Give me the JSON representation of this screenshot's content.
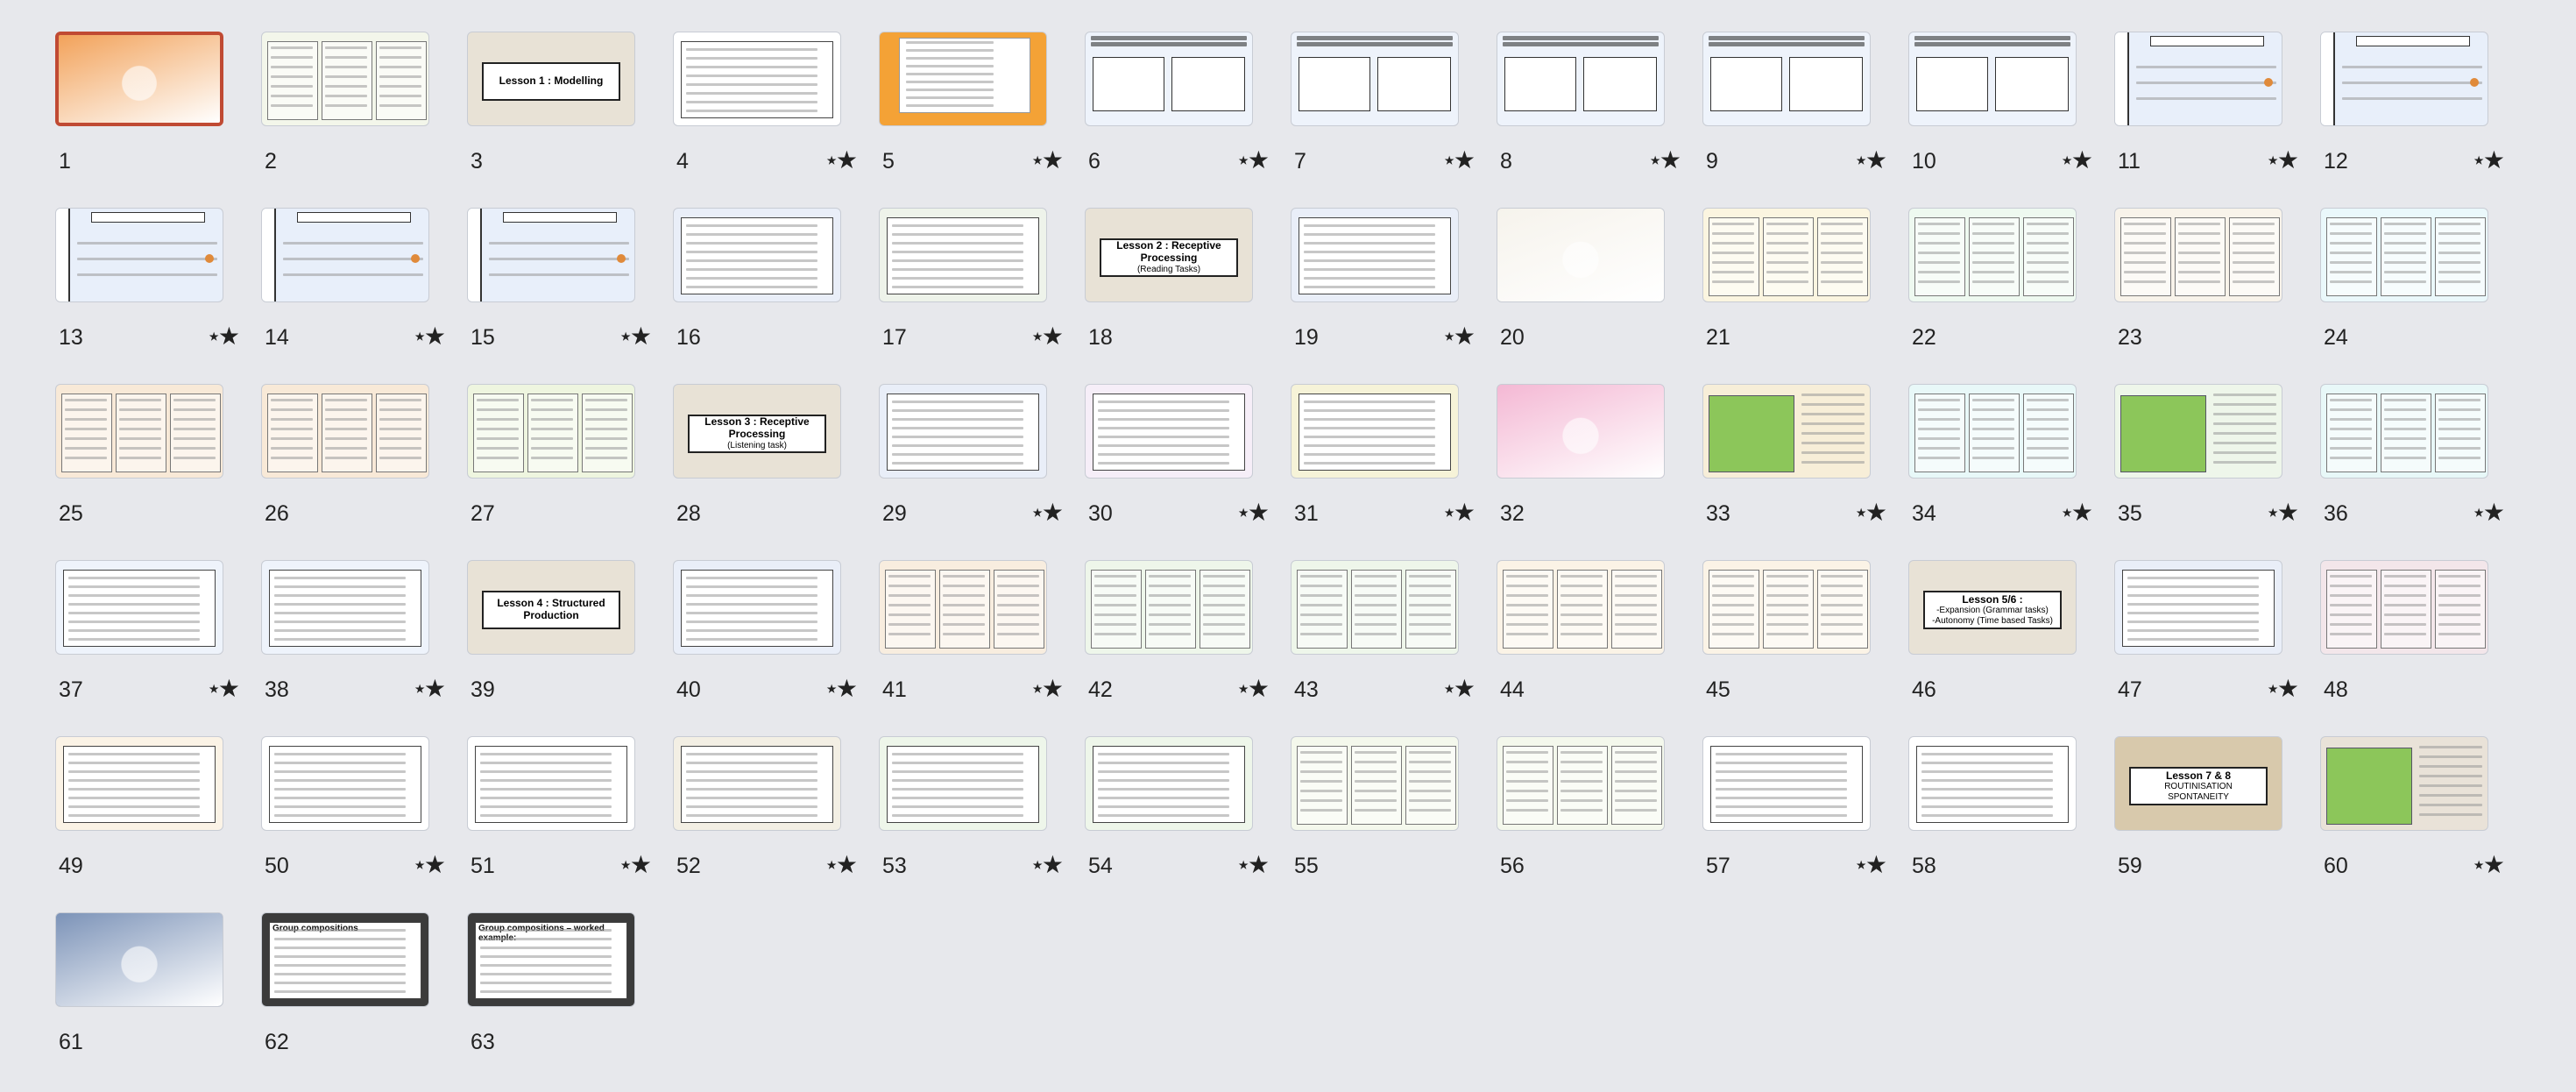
{
  "slides": [
    {
      "n": "1",
      "kind": "image",
      "bg": "#f2a25a",
      "selected": true,
      "text": "",
      "star": false
    },
    {
      "n": "2",
      "kind": "table",
      "bg": "#f3f6ea",
      "text": "",
      "star": false
    },
    {
      "n": "3",
      "kind": "title",
      "bg": "#e8e2d6",
      "text": "Lesson 1 : Modelling",
      "star": false
    },
    {
      "n": "4",
      "kind": "lines",
      "bg": "#ffffff",
      "text": "",
      "star": true
    },
    {
      "n": "5",
      "kind": "orange",
      "bg": "#f4a236",
      "text": "",
      "star": true
    },
    {
      "n": "6",
      "kind": "two",
      "bg": "#eef3fb",
      "text": "",
      "star": true
    },
    {
      "n": "7",
      "kind": "two",
      "bg": "#eef3fb",
      "text": "",
      "star": true
    },
    {
      "n": "8",
      "kind": "two",
      "bg": "#eef3fb",
      "text": "",
      "star": true
    },
    {
      "n": "9",
      "kind": "two",
      "bg": "#eef3fb",
      "text": "",
      "star": true
    },
    {
      "n": "10",
      "kind": "two",
      "bg": "#eef3fb",
      "text": "",
      "star": true
    },
    {
      "n": "11",
      "kind": "mc",
      "bg": "#e8effa",
      "text": "",
      "star": true
    },
    {
      "n": "12",
      "kind": "mc",
      "bg": "#e8effa",
      "text": "",
      "star": true
    },
    {
      "n": "13",
      "kind": "mc",
      "bg": "#e8effa",
      "text": "",
      "star": true
    },
    {
      "n": "14",
      "kind": "mc",
      "bg": "#e8effa",
      "text": "",
      "star": true
    },
    {
      "n": "15",
      "kind": "mc",
      "bg": "#e8effa",
      "text": "",
      "star": true
    },
    {
      "n": "16",
      "kind": "lines",
      "bg": "#e9eef8",
      "text": "",
      "star": false
    },
    {
      "n": "17",
      "kind": "lines",
      "bg": "#eef3ea",
      "text": "",
      "star": true
    },
    {
      "n": "18",
      "kind": "title",
      "bg": "#e8e2d6",
      "text": "Lesson 2 : Receptive Processing",
      "sub": "(Reading Tasks)",
      "star": false
    },
    {
      "n": "19",
      "kind": "lines",
      "bg": "#e9eef8",
      "text": "",
      "star": true
    },
    {
      "n": "20",
      "kind": "image",
      "bg": "#f6f3ec",
      "text": "",
      "star": false
    },
    {
      "n": "21",
      "kind": "table",
      "bg": "#fbf5e0",
      "text": "",
      "star": false
    },
    {
      "n": "22",
      "kind": "table",
      "bg": "#eef9f0",
      "text": "",
      "star": false
    },
    {
      "n": "23",
      "kind": "table",
      "bg": "#f8f3ea",
      "text": "",
      "star": false
    },
    {
      "n": "24",
      "kind": "table",
      "bg": "#eaf8fb",
      "text": "",
      "star": false
    },
    {
      "n": "25",
      "kind": "table",
      "bg": "#f8e9d7",
      "text": "",
      "star": false
    },
    {
      "n": "26",
      "kind": "table",
      "bg": "#f8e9d7",
      "text": "",
      "star": false
    },
    {
      "n": "27",
      "kind": "table",
      "bg": "#eef5df",
      "text": "",
      "star": false
    },
    {
      "n": "28",
      "kind": "title",
      "bg": "#e8e2d6",
      "text": "Lesson 3 : Receptive Processing",
      "sub": "(Listening task)",
      "star": false
    },
    {
      "n": "29",
      "kind": "lines",
      "bg": "#e9eef8",
      "text": "",
      "star": true
    },
    {
      "n": "30",
      "kind": "lines",
      "bg": "#f6eef8",
      "text": "",
      "star": true
    },
    {
      "n": "31",
      "kind": "lines",
      "bg": "#f6f3d8",
      "text": "",
      "star": true
    },
    {
      "n": "32",
      "kind": "image",
      "bg": "#f4b8d4",
      "text": "",
      "star": false
    },
    {
      "n": "33",
      "kind": "green",
      "bg": "#f7eed8",
      "text": "",
      "star": true
    },
    {
      "n": "34",
      "kind": "table",
      "bg": "#e8f8f8",
      "text": "",
      "star": true
    },
    {
      "n": "35",
      "kind": "green",
      "bg": "#eef6ea",
      "text": "",
      "star": true
    },
    {
      "n": "36",
      "kind": "table",
      "bg": "#e8f8f8",
      "text": "",
      "star": true
    },
    {
      "n": "37",
      "kind": "lines",
      "bg": "#eef3fb",
      "text": "",
      "star": true
    },
    {
      "n": "38",
      "kind": "lines",
      "bg": "#eef3fb",
      "text": "",
      "star": true
    },
    {
      "n": "39",
      "kind": "title",
      "bg": "#e8e2d6",
      "text": "Lesson 4 : Structured Production",
      "star": false
    },
    {
      "n": "40",
      "kind": "lines",
      "bg": "#e9eef8",
      "text": "",
      "star": true
    },
    {
      "n": "41",
      "kind": "table",
      "bg": "#f8eddf",
      "text": "",
      "star": true
    },
    {
      "n": "42",
      "kind": "table",
      "bg": "#eef6ea",
      "text": "",
      "star": true
    },
    {
      "n": "43",
      "kind": "table",
      "bg": "#eef6ea",
      "text": "",
      "star": true
    },
    {
      "n": "44",
      "kind": "table",
      "bg": "#fbf3e6",
      "text": "",
      "star": false
    },
    {
      "n": "45",
      "kind": "table",
      "bg": "#fbf3e6",
      "text": "",
      "star": false
    },
    {
      "n": "46",
      "kind": "title",
      "bg": "#e8e2d6",
      "text": "Lesson 5/6 :",
      "sub": "-Expansion (Grammar tasks)\n-Autonomy (Time based Tasks)",
      "star": false
    },
    {
      "n": "47",
      "kind": "lines",
      "bg": "#e9eef8",
      "text": "",
      "star": true
    },
    {
      "n": "48",
      "kind": "table",
      "bg": "#f3e6ea",
      "text": "",
      "star": false
    },
    {
      "n": "49",
      "kind": "lines",
      "bg": "#fbf3e6",
      "text": "",
      "star": false
    },
    {
      "n": "50",
      "kind": "lines",
      "bg": "#ffffff",
      "text": "",
      "star": true
    },
    {
      "n": "51",
      "kind": "lines",
      "bg": "#ffffff",
      "text": "",
      "star": true
    },
    {
      "n": "52",
      "kind": "lines",
      "bg": "#f3efe4",
      "text": "",
      "star": true
    },
    {
      "n": "53",
      "kind": "lines",
      "bg": "#eef6ea",
      "text": "",
      "star": true
    },
    {
      "n": "54",
      "kind": "lines",
      "bg": "#eef6ea",
      "text": "",
      "star": true
    },
    {
      "n": "55",
      "kind": "table",
      "bg": "#f4f8ec",
      "text": "",
      "star": false
    },
    {
      "n": "56",
      "kind": "table",
      "bg": "#f4f8ec",
      "text": "",
      "star": false
    },
    {
      "n": "57",
      "kind": "lines",
      "bg": "#ffffff",
      "text": "",
      "star": true
    },
    {
      "n": "58",
      "kind": "lines",
      "bg": "#ffffff",
      "text": "",
      "star": false
    },
    {
      "n": "59",
      "kind": "title",
      "bg": "#d8c9ac",
      "text": "Lesson 7 & 8",
      "sub": "ROUTINISATION\nSPONTANEITY",
      "star": false
    },
    {
      "n": "60",
      "kind": "green",
      "bg": "#e9e2d8",
      "text": "",
      "star": true
    },
    {
      "n": "61",
      "kind": "image",
      "bg": "#7c93b8",
      "text": "",
      "star": false
    },
    {
      "n": "62",
      "kind": "lines",
      "bg": "#3b3b3b",
      "text": "Group compositions",
      "star": false
    },
    {
      "n": "63",
      "kind": "lines",
      "bg": "#3b3b3b",
      "text": "Group compositions – worked example:",
      "star": false
    }
  ]
}
